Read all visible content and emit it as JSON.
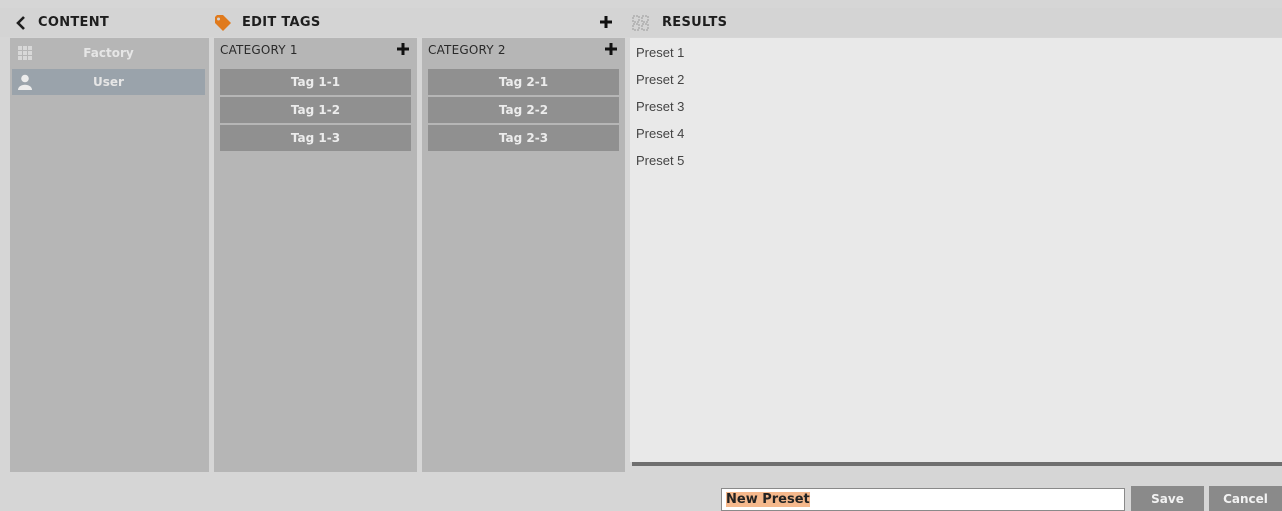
{
  "header": {
    "content_title": "CONTENT",
    "tags_title": "EDIT TAGS",
    "results_title": "RESULTS"
  },
  "sources": [
    {
      "label": "Factory",
      "icon": "grid-icon"
    },
    {
      "label": "User",
      "icon": "user-icon",
      "selected": true
    }
  ],
  "categories": [
    {
      "title": "CATEGORY 1",
      "tags": [
        "Tag 1-1",
        "Tag 1-2",
        "Tag 1-3"
      ]
    },
    {
      "title": "CATEGORY 2",
      "tags": [
        "Tag 2-1",
        "Tag 2-2",
        "Tag 2-3"
      ]
    }
  ],
  "results": [
    "Preset 1",
    "Preset 2",
    "Preset 3",
    "Preset 4",
    "Preset 5"
  ],
  "footer": {
    "preset_name": "New Preset",
    "save_label": "Save",
    "cancel_label": "Cancel"
  },
  "colors": {
    "accent": "#e07a1c",
    "selection_highlight": "#f5b88c"
  }
}
